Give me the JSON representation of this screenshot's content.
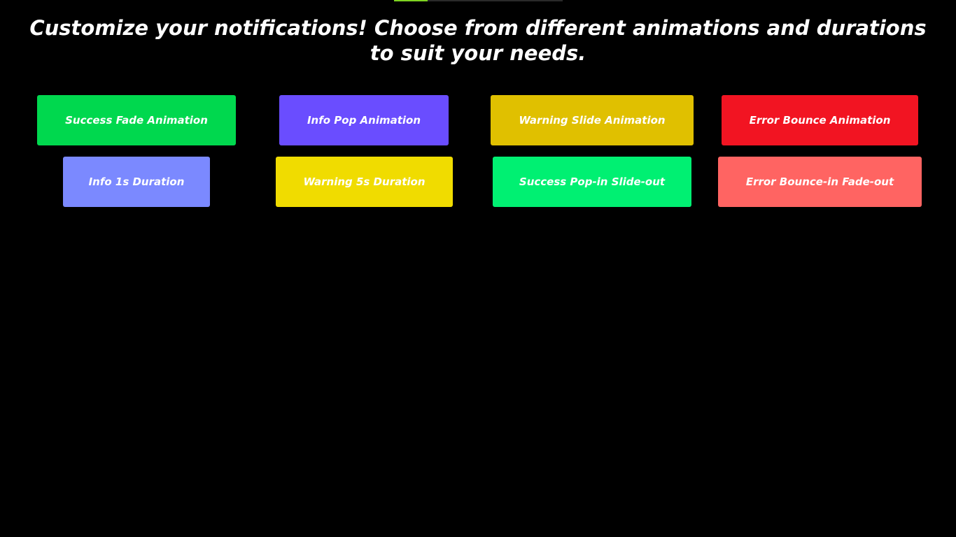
{
  "progress": {
    "fraction": 0.2,
    "color": "#7ed321",
    "track_color": "#2a2a2a"
  },
  "headline": "Customize your notifications! Choose from different animations and durations to suit your needs.",
  "buttons": [
    {
      "label": "Success Fade Animation",
      "color": "#00d84e"
    },
    {
      "label": "Info Pop Animation",
      "color": "#6a4dff"
    },
    {
      "label": "Warning Slide Animation",
      "color": "#e0c000"
    },
    {
      "label": "Error Bounce Animation",
      "color": "#f21422"
    },
    {
      "label": "Info 1s Duration",
      "color": "#7b89ff"
    },
    {
      "label": "Warning 5s Duration",
      "color": "#f0dc00"
    },
    {
      "label": "Success Pop-in Slide-out",
      "color": "#00f072"
    },
    {
      "label": "Error Bounce-in Fade-out",
      "color": "#ff6462"
    }
  ]
}
